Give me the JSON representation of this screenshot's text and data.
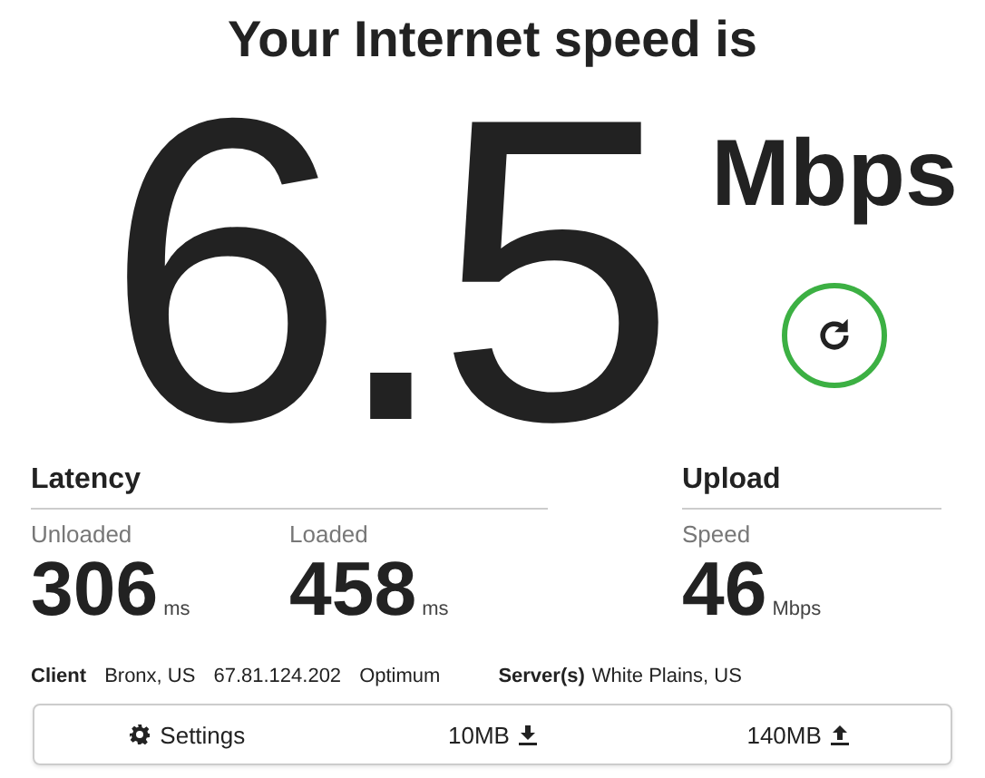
{
  "title": "Your Internet speed is",
  "speed": {
    "value": "6.5",
    "unit": "Mbps"
  },
  "latency": {
    "heading": "Latency",
    "metrics": [
      {
        "label": "Unloaded",
        "value": "306",
        "unit": "ms"
      },
      {
        "label": "Loaded",
        "value": "458",
        "unit": "ms"
      }
    ]
  },
  "upload": {
    "heading": "Upload",
    "metrics": [
      {
        "label": "Speed",
        "value": "46",
        "unit": "Mbps"
      }
    ]
  },
  "client": {
    "label": "Client",
    "location": "Bronx, US",
    "ip": "67.81.124.202",
    "isp": "Optimum"
  },
  "server": {
    "label": "Server(s)",
    "location": "White Plains, US"
  },
  "toolbar": [
    {
      "kind": "settings",
      "label": "Settings"
    },
    {
      "kind": "download",
      "label": "10MB"
    },
    {
      "kind": "upload",
      "label": "140MB"
    }
  ]
}
